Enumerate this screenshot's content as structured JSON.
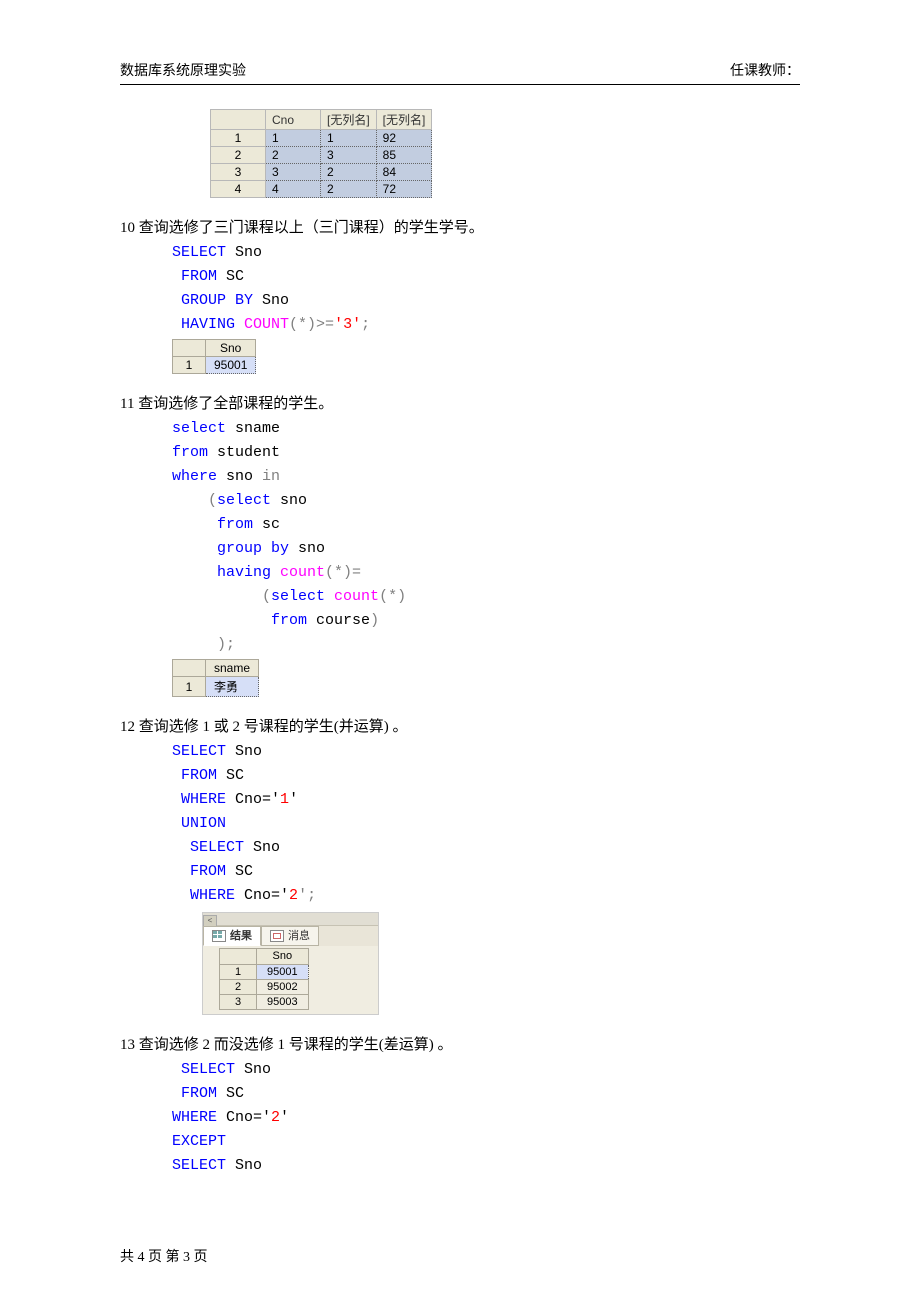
{
  "header": {
    "left": "数据库系统原理实验",
    "right": "任课教师："
  },
  "footer": "共 4 页  第 3 页",
  "top_table": {
    "cols": [
      "Cno",
      "[无列名]",
      "[无列名]"
    ],
    "rows": [
      [
        "1",
        "1",
        "92"
      ],
      [
        "2",
        "3",
        "85"
      ],
      [
        "3",
        "2",
        "84"
      ],
      [
        "4",
        "2",
        "72"
      ]
    ]
  },
  "q10": {
    "title": "10  查询选修了三门课程以上（三门课程）的学生学号。",
    "c1": "SELECT",
    "a1": " Sno",
    "c2": "FROM",
    "a2": " SC",
    "c3": "GROUP BY",
    "a3": " Sno",
    "c4": "HAVING ",
    "fn": "COUNT",
    "a4": "(*)>='",
    "lit": "3",
    "a5": "';",
    "res": {
      "col": "Sno",
      "rows": [
        [
          "95001"
        ]
      ]
    }
  },
  "q11": {
    "title": "11  查询选修了全部课程的学生。",
    "l": [
      "select",
      " sname",
      "from",
      " student",
      "where",
      " sno ",
      "in",
      "select",
      " sno",
      "from",
      " sc",
      "group by",
      " sno",
      "having ",
      "count",
      "(*)=",
      "select ",
      "count",
      "(*)",
      "from",
      " course",
      "          );"
    ],
    "paren1": "    (",
    "paren_close": ")",
    "res": {
      "col": "sname",
      "rows": [
        [
          "李勇"
        ]
      ]
    }
  },
  "q12": {
    "title": "12  查询选修 1 或 2 号课程的学生(并运算)  。",
    "l": [
      "SELECT",
      " Sno",
      "FROM",
      " SC",
      "WHERE",
      " Cno='",
      "1",
      "'",
      "UNION",
      "SELECT",
      " Sno",
      "FROM",
      " SC",
      "WHERE",
      " Cno='",
      "2",
      "';"
    ],
    "panel": {
      "tab1": "结果",
      "tab2": "消息",
      "col": "Sno",
      "rows": [
        [
          "95001"
        ],
        [
          "95002"
        ],
        [
          "95003"
        ]
      ]
    }
  },
  "q13": {
    "title": "13  查询选修 2 而没选修 1 号课程的学生(差运算)  。",
    "l": [
      "SELECT",
      " Sno",
      "FROM",
      " SC",
      "WHERE",
      " Cno='",
      "2",
      "'",
      "EXCEPT",
      "SELECT",
      " Sno"
    ]
  }
}
